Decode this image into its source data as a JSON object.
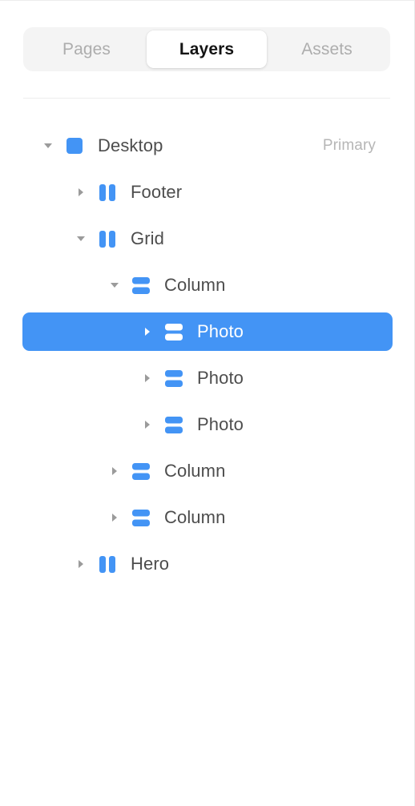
{
  "panel": {
    "background_color": "#ffffff",
    "accent_color": "#4394f5",
    "selected_row_color": "#4394f5"
  },
  "tabs": {
    "items": [
      {
        "label": "Pages",
        "name": "tab-pages",
        "active": false
      },
      {
        "label": "Layers",
        "name": "tab-layers",
        "active": true
      },
      {
        "label": "Assets",
        "name": "tab-assets",
        "active": false
      }
    ]
  },
  "layers": {
    "rows": [
      {
        "label": "Desktop",
        "icon": "artboard-square-icon",
        "depth": 0,
        "twisty": "expanded",
        "selected": false,
        "badge": "Primary"
      },
      {
        "label": "Footer",
        "icon": "columns-vertical-icon",
        "depth": 1,
        "twisty": "collapsed",
        "selected": false,
        "badge": ""
      },
      {
        "label": "Grid",
        "icon": "columns-vertical-icon",
        "depth": 1,
        "twisty": "expanded",
        "selected": false,
        "badge": ""
      },
      {
        "label": "Column",
        "icon": "rows-horizontal-icon",
        "depth": 2,
        "twisty": "expanded",
        "selected": false,
        "badge": ""
      },
      {
        "label": "Photo",
        "icon": "rows-horizontal-icon",
        "depth": 3,
        "twisty": "collapsed",
        "selected": true,
        "badge": ""
      },
      {
        "label": "Photo",
        "icon": "rows-horizontal-icon",
        "depth": 3,
        "twisty": "collapsed",
        "selected": false,
        "badge": ""
      },
      {
        "label": "Photo",
        "icon": "rows-horizontal-icon",
        "depth": 3,
        "twisty": "collapsed",
        "selected": false,
        "badge": ""
      },
      {
        "label": "Column",
        "icon": "rows-horizontal-icon",
        "depth": 2,
        "twisty": "collapsed",
        "selected": false,
        "badge": ""
      },
      {
        "label": "Column",
        "icon": "rows-horizontal-icon",
        "depth": 2,
        "twisty": "collapsed",
        "selected": false,
        "badge": ""
      },
      {
        "label": "Hero",
        "icon": "columns-vertical-icon",
        "depth": 1,
        "twisty": "collapsed",
        "selected": false,
        "badge": ""
      }
    ]
  }
}
